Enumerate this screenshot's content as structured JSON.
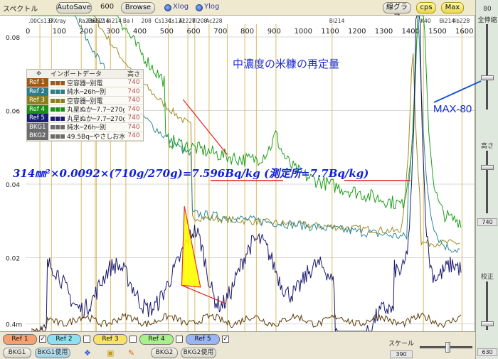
{
  "toolbar": {
    "title": "スペクトル",
    "autosave_label": "AutoSave",
    "time_value": "600",
    "browse_label": "Browse",
    "xlog_label": "Xlog",
    "ylog_label": "Ylog",
    "linegraph_label": "線グラフ",
    "cps_label": "cps",
    "max_label": "Max"
  },
  "plot": {
    "y_ticks": [
      "0.08",
      "0.06",
      "0.04",
      "0.02",
      "0.4m"
    ],
    "x_ticks": [
      "0",
      "100",
      "200",
      "300",
      "400",
      "500",
      "600",
      "700",
      "800",
      "900",
      "1000",
      "1100",
      "1200",
      "1300",
      "1400",
      "1500",
      "1600"
    ],
    "nuclide_labels": [
      ".00Cs137",
      "BiXray",
      "Ra226",
      "Pb212",
      "Pb214",
      "Bi214",
      "Ba",
      "I",
      "208",
      "Cs134",
      "Cs137",
      "Ac228",
      "Tl208",
      "Ac228",
      "Bi214",
      "K40",
      "Bi214",
      "4b228"
    ],
    "note_title": "中濃度の米糠の再定量",
    "formula": "314㎜²×0.0092×(710g/270g)=7.596Bq/kg (測定所=7.7Bq/kg)",
    "max_note": "MAX-80",
    "colors": {
      "ref1": "#b97a20",
      "ref2": "#2f8a94",
      "ref3": "#9e8a22",
      "ref4": "#1fa01a",
      "ref5": "#1a1a6e",
      "bkg1": "#5a3d0a",
      "highlight": "#ffff00",
      "annotation": "#e02020",
      "nuclide_line": "#d4b04a"
    }
  },
  "legend": {
    "header_data": "インポートデータ",
    "header_height": "高さ",
    "rows": [
      {
        "tag": "Ref 1",
        "color": "#9b5a1a",
        "data": "空容器─別電",
        "num": "740"
      },
      {
        "tag": "Ref 2",
        "color": "#2c7d88",
        "data": "純水─26h─別",
        "num": "740"
      },
      {
        "tag": "Ref 3",
        "color": "#8b7f1f",
        "data": "空容器─別電",
        "num": "740"
      },
      {
        "tag": "Ref 4",
        "color": "#1c8f18",
        "data": "丸星ぬか─7.7─270g─4h",
        "num": "740"
      },
      {
        "tag": "Ref 5",
        "color": "#1c1d70",
        "data": "丸星ぬか─7.7─270g─4h",
        "num": "740"
      },
      {
        "tag": "BKG1",
        "color": "#6c6c6c",
        "data": "純水─26h─別",
        "num": "740"
      },
      {
        "tag": "BKG2",
        "color": "#6c6c6c",
        "data": "49.5Bq─やさしお水─3",
        "num": "740"
      }
    ]
  },
  "right_panel": {
    "top_value": "80",
    "zoom_label": "全伸縮",
    "height_label": "高さ",
    "height_value": "740",
    "calib_label": "校正",
    "calib_value": "630"
  },
  "bottom": {
    "refs": [
      {
        "label": "Ref 1",
        "checked": true,
        "color": "#f5a070"
      },
      {
        "label": "Ref 2",
        "checked": false,
        "color": "#8fe0f0"
      },
      {
        "label": "Ref 3",
        "checked": false,
        "color": "#f7e26a"
      },
      {
        "label": "Ref 4",
        "checked": false,
        "color": "#a8f08a"
      },
      {
        "label": "Ref 5",
        "checked": true,
        "color": "#9ab5f5"
      }
    ],
    "bkg1_label": "BKG1",
    "bkg1_use_label": "BKG1使用",
    "bkg2_label": "BKG2",
    "bkg2_use_label": "BKG2使用",
    "scale_label": "スケール",
    "scale_value": "390"
  }
}
